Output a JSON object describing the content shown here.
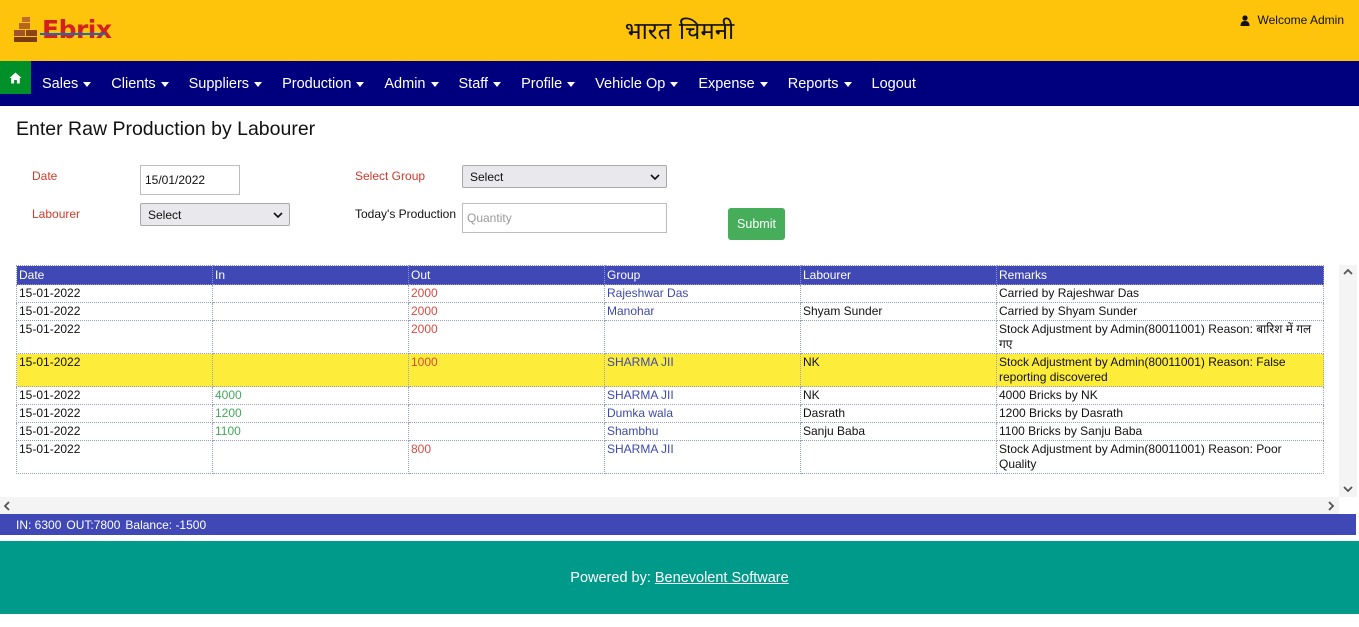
{
  "header": {
    "logo_text": "Ebrix",
    "brand_title": "भारत चिमनी",
    "welcome_text": "Welcome Admin"
  },
  "nav": {
    "items": [
      {
        "label": "Sales",
        "dropdown": true
      },
      {
        "label": "Clients",
        "dropdown": true
      },
      {
        "label": "Suppliers",
        "dropdown": true
      },
      {
        "label": "Production",
        "dropdown": true
      },
      {
        "label": "Admin",
        "dropdown": true
      },
      {
        "label": "Staff",
        "dropdown": true
      },
      {
        "label": "Profile",
        "dropdown": true
      },
      {
        "label": "Vehicle Op",
        "dropdown": true
      },
      {
        "label": "Expense",
        "dropdown": true
      },
      {
        "label": "Reports",
        "dropdown": true
      },
      {
        "label": "Logout",
        "dropdown": false
      }
    ]
  },
  "page": {
    "title": "Enter Raw Production by Labourer"
  },
  "form": {
    "date_label": "Date",
    "date_value": "15/01/2022",
    "labourer_label": "Labourer",
    "labourer_selected": "Select",
    "group_label": "Select Group",
    "group_selected": "Select",
    "production_label": "Today's Production",
    "production_placeholder": "Quantity",
    "submit_label": "Submit"
  },
  "table": {
    "headers": [
      "Date",
      "In",
      "Out",
      "Group",
      "Labourer",
      "Remarks"
    ],
    "rows": [
      {
        "date": "15-01-2022",
        "in": "",
        "out": "2000",
        "group": "Rajeshwar Das",
        "labourer": "",
        "remarks": "Carried by Rajeshwar Das",
        "highlight": false
      },
      {
        "date": "15-01-2022",
        "in": "",
        "out": "2000",
        "group": "Manohar",
        "labourer": "Shyam Sunder",
        "remarks": "Carried by Shyam Sunder",
        "highlight": false
      },
      {
        "date": "15-01-2022",
        "in": "",
        "out": "2000",
        "group": "",
        "labourer": "",
        "remarks": "Stock Adjustment by Admin(80011001) Reason: बारिश में गल गए",
        "highlight": false
      },
      {
        "date": "15-01-2022",
        "in": "",
        "out": "1000",
        "group": "SHARMA JII",
        "labourer": "NK",
        "remarks": "Stock Adjustment by Admin(80011001) Reason: False reporting discovered",
        "highlight": true
      },
      {
        "date": "15-01-2022",
        "in": "4000",
        "out": "",
        "group": "SHARMA JII",
        "labourer": "NK",
        "remarks": "4000 Bricks by NK",
        "highlight": false
      },
      {
        "date": "15-01-2022",
        "in": "1200",
        "out": "",
        "group": "Dumka wala",
        "labourer": "Dasrath",
        "remarks": "1200 Bricks by Dasrath",
        "highlight": false
      },
      {
        "date": "15-01-2022",
        "in": "1100",
        "out": "",
        "group": "Shambhu",
        "labourer": "Sanju Baba",
        "remarks": "1100 Bricks by Sanju Baba",
        "highlight": false
      },
      {
        "date": "15-01-2022",
        "in": "",
        "out": "800",
        "group": "SHARMA JII",
        "labourer": "",
        "remarks": "Stock Adjustment by Admin(80011001) Reason: Poor Quality",
        "highlight": false
      }
    ]
  },
  "summary": {
    "in_text": "IN: 6300",
    "out_text": "OUT:7800",
    "balance_text": "Balance: -1500"
  },
  "footer": {
    "powered_by": "Powered by:",
    "company_link": "Benevolent Software"
  },
  "colors": {
    "topbar": "#fec40c",
    "navbar": "#00007f",
    "home_button": "#00902a",
    "table_header": "#3f48b5",
    "highlight_row": "#fdec3a",
    "submit": "#46ad5a",
    "footer": "#009a8a"
  },
  "icons": {
    "home": "home-icon",
    "user": "user-icon",
    "logo": "bricks-logo-icon"
  }
}
